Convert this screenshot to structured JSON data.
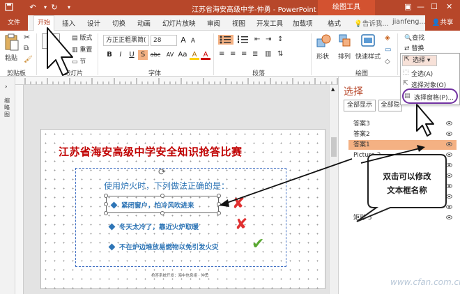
{
  "window": {
    "title": "江苏省海安高级中学-仲勇 - PowerPoint",
    "context_tab_group": "绘图工具",
    "account": "jianfeng...",
    "share_label": "共享",
    "tellme": "告诉我..."
  },
  "tabs": [
    "文件",
    "开始",
    "插入",
    "设计",
    "切换",
    "动画",
    "幻灯片放映",
    "审阅",
    "视图",
    "开发工具",
    "加载项",
    "格式"
  ],
  "ribbon": {
    "clipboard": {
      "paste": "粘贴",
      "group": "剪贴板"
    },
    "slides": {
      "layout": "版式",
      "reset": "重置",
      "section": "节",
      "group": "幻灯片"
    },
    "font": {
      "name": "方正正粗黑简(",
      "size": "28",
      "group": "字体",
      "buttons": [
        "B",
        "I",
        "U",
        "S",
        "abc",
        "AV",
        "Aa",
        "A",
        "A"
      ]
    },
    "paragraph": {
      "group": "段落"
    },
    "drawing": {
      "shape": "形状",
      "arrange": "排列",
      "quickstyle": "快速样式",
      "group": "绘图"
    },
    "editing": {
      "find": "查找",
      "replace": "替换",
      "select": "选择"
    }
  },
  "menu": {
    "header": "选择",
    "items": [
      "全选(A)",
      "选择对象(O)",
      "选择窗格(P)..."
    ]
  },
  "slide": {
    "title": "江苏省海安高级中学安全知识抢答比赛",
    "question": "使用炉火时，下列做法正确的是：",
    "options": [
      {
        "text": "紧闭窗户，怕冷风吹进来",
        "mark": "✘"
      },
      {
        "text": "冬天太冷了，靠近火炉取暖",
        "mark": "✘"
      },
      {
        "text": "不在炉边堆放易燃物以免引发火灾",
        "mark": "✔"
      }
    ],
    "footer": "抢答系统开发：海中信息组 · 仲勇",
    "colors": {
      "title": "#c00000",
      "text": "#2e75b6",
      "wrong": "#e03030",
      "right": "#5aa832"
    }
  },
  "left_strip_label": "缩略图",
  "pane": {
    "title": "选择",
    "show_all": "全部显示",
    "hide_all": "全部隐",
    "items": [
      "答案3",
      "答案2",
      "答案1",
      "Picture 2",
      "",
      "",
      "",
      "",
      "",
      "矩形 5"
    ],
    "active_index": 2
  },
  "callout": {
    "line1": "双击可以修改",
    "line2": "文本框名称"
  },
  "watermark": "www.cfan.com.cn"
}
